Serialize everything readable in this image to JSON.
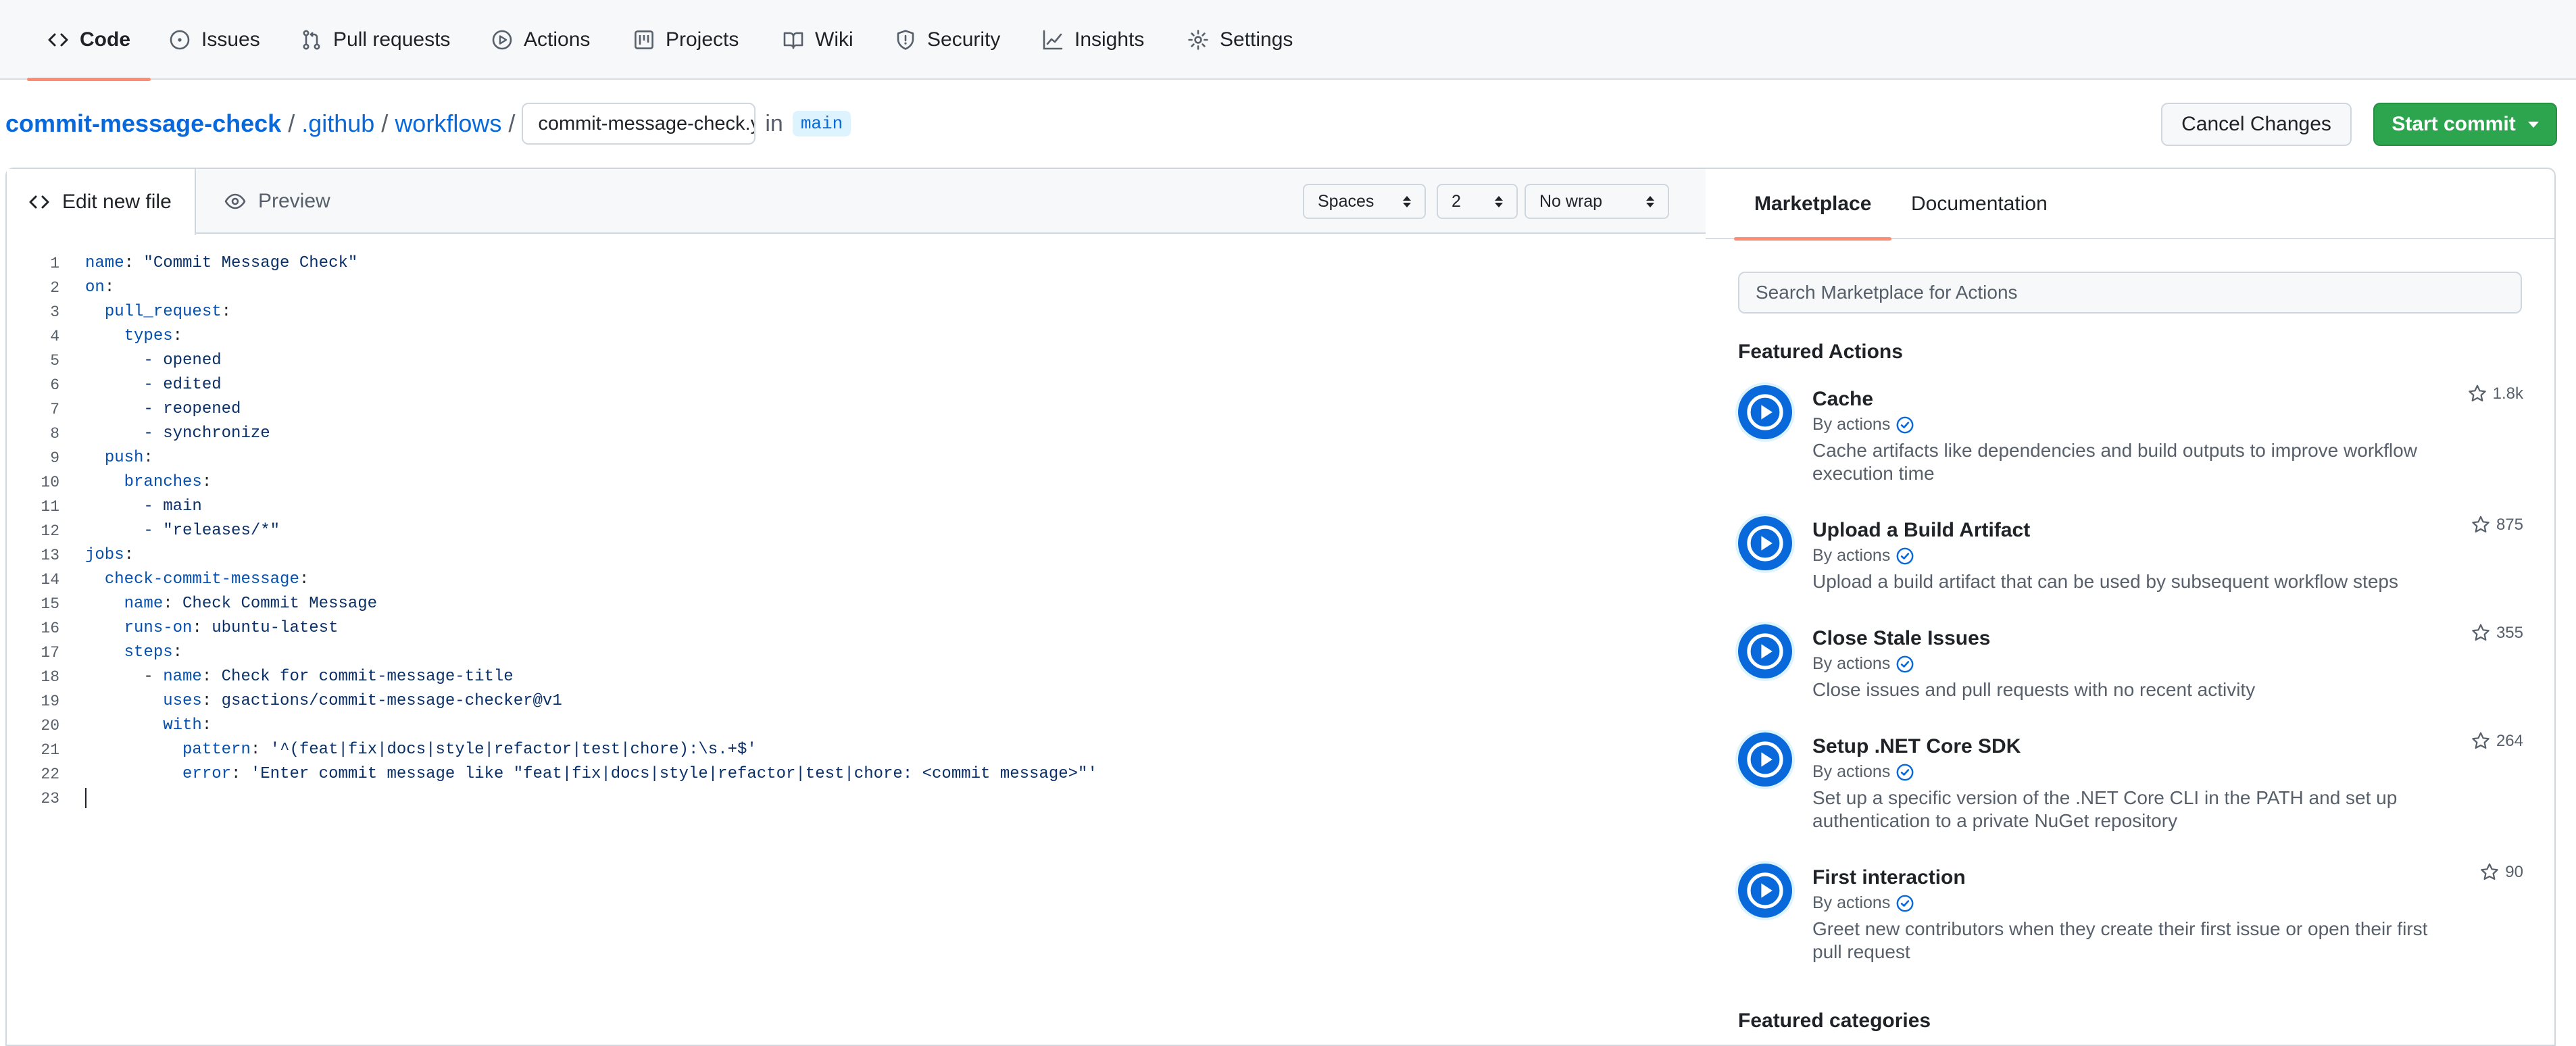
{
  "nav": {
    "tabs": [
      {
        "label": "Code"
      },
      {
        "label": "Issues"
      },
      {
        "label": "Pull requests"
      },
      {
        "label": "Actions"
      },
      {
        "label": "Projects"
      },
      {
        "label": "Wiki"
      },
      {
        "label": "Security"
      },
      {
        "label": "Insights"
      },
      {
        "label": "Settings"
      }
    ]
  },
  "breadcrumb": {
    "repo": "commit-message-check",
    "sep": "/",
    "dir1": ".github",
    "dir2": "workflows",
    "filename": "commit-message-check.yml",
    "in": "in",
    "branch": "main"
  },
  "buttons": {
    "cancel": "Cancel Changes",
    "commit": "Start commit"
  },
  "editor": {
    "tab_edit": "Edit new file",
    "tab_preview": "Preview",
    "indent_mode": "Spaces",
    "indent_size": "2",
    "wrap_mode": "No wrap",
    "lines": [
      {
        "n": "1",
        "indent": "",
        "key": "name",
        "sep": ": ",
        "val": "\"Commit Message Check\""
      },
      {
        "n": "2",
        "indent": "",
        "key": "on",
        "sep": ":",
        "val": ""
      },
      {
        "n": "3",
        "indent": "  ",
        "key": "pull_request",
        "sep": ":",
        "val": ""
      },
      {
        "n": "4",
        "indent": "    ",
        "key": "types",
        "sep": ":",
        "val": ""
      },
      {
        "n": "5",
        "indent": "      ",
        "key": "",
        "sep": "",
        "val": "- opened"
      },
      {
        "n": "6",
        "indent": "      ",
        "key": "",
        "sep": "",
        "val": "- edited"
      },
      {
        "n": "7",
        "indent": "      ",
        "key": "",
        "sep": "",
        "val": "- reopened"
      },
      {
        "n": "8",
        "indent": "      ",
        "key": "",
        "sep": "",
        "val": "- synchronize"
      },
      {
        "n": "9",
        "indent": "  ",
        "key": "push",
        "sep": ":",
        "val": ""
      },
      {
        "n": "10",
        "indent": "    ",
        "key": "branches",
        "sep": ":",
        "val": ""
      },
      {
        "n": "11",
        "indent": "      ",
        "key": "",
        "sep": "",
        "val": "- main"
      },
      {
        "n": "12",
        "indent": "      ",
        "key": "",
        "sep": "",
        "val": "- \"releases/*\""
      },
      {
        "n": "13",
        "indent": "",
        "key": "jobs",
        "sep": ":",
        "val": ""
      },
      {
        "n": "14",
        "indent": "  ",
        "key": "check-commit-message",
        "sep": ":",
        "val": ""
      },
      {
        "n": "15",
        "indent": "    ",
        "key": "name",
        "sep": ": ",
        "val": "Check Commit Message"
      },
      {
        "n": "16",
        "indent": "    ",
        "key": "runs-on",
        "sep": ": ",
        "val": "ubuntu-latest"
      },
      {
        "n": "17",
        "indent": "    ",
        "key": "steps",
        "sep": ":",
        "val": ""
      },
      {
        "n": "18",
        "indent": "      - ",
        "key": "name",
        "sep": ": ",
        "val": "Check for commit-message-title"
      },
      {
        "n": "19",
        "indent": "        ",
        "key": "uses",
        "sep": ": ",
        "val": "gsactions/commit-message-checker@v1"
      },
      {
        "n": "20",
        "indent": "        ",
        "key": "with",
        "sep": ":",
        "val": ""
      },
      {
        "n": "21",
        "indent": "          ",
        "key": "pattern",
        "sep": ": ",
        "val": "'^(feat|fix|docs|style|refactor|test|chore):\\s.+$'"
      },
      {
        "n": "22",
        "indent": "          ",
        "key": "error",
        "sep": ": ",
        "val": "'Enter commit message like \"feat|fix|docs|style|refactor|test|chore: <commit message>\"'"
      },
      {
        "n": "23",
        "indent": "",
        "key": "",
        "sep": "",
        "val": ""
      }
    ]
  },
  "marketplace": {
    "tab_marketplace": "Marketplace",
    "tab_docs": "Documentation",
    "search_placeholder": "Search Marketplace for Actions",
    "featured_heading": "Featured Actions",
    "categories_heading": "Featured categories",
    "actions": [
      {
        "title": "Cache",
        "by": "By actions",
        "desc": "Cache artifacts like dependencies and build outputs to improve workflow execution time",
        "stars": "1.8k"
      },
      {
        "title": "Upload a Build Artifact",
        "by": "By actions",
        "desc": "Upload a build artifact that can be used by subsequent workflow steps",
        "stars": "875"
      },
      {
        "title": "Close Stale Issues",
        "by": "By actions",
        "desc": "Close issues and pull requests with no recent activity",
        "stars": "355"
      },
      {
        "title": "Setup .NET Core SDK",
        "by": "By actions",
        "desc": "Set up a specific version of the .NET Core CLI in the PATH and set up authentication to a private NuGet repository",
        "stars": "264"
      },
      {
        "title": "First interaction",
        "by": "By actions",
        "desc": "Greet new contributors when they create their first issue or open their first pull request",
        "stars": "90"
      }
    ]
  },
  "colors": {
    "link": "#0969da",
    "commit_button": "#2da44e",
    "tab_underline": "#fd8c73",
    "yaml_key": "#0550ae"
  }
}
